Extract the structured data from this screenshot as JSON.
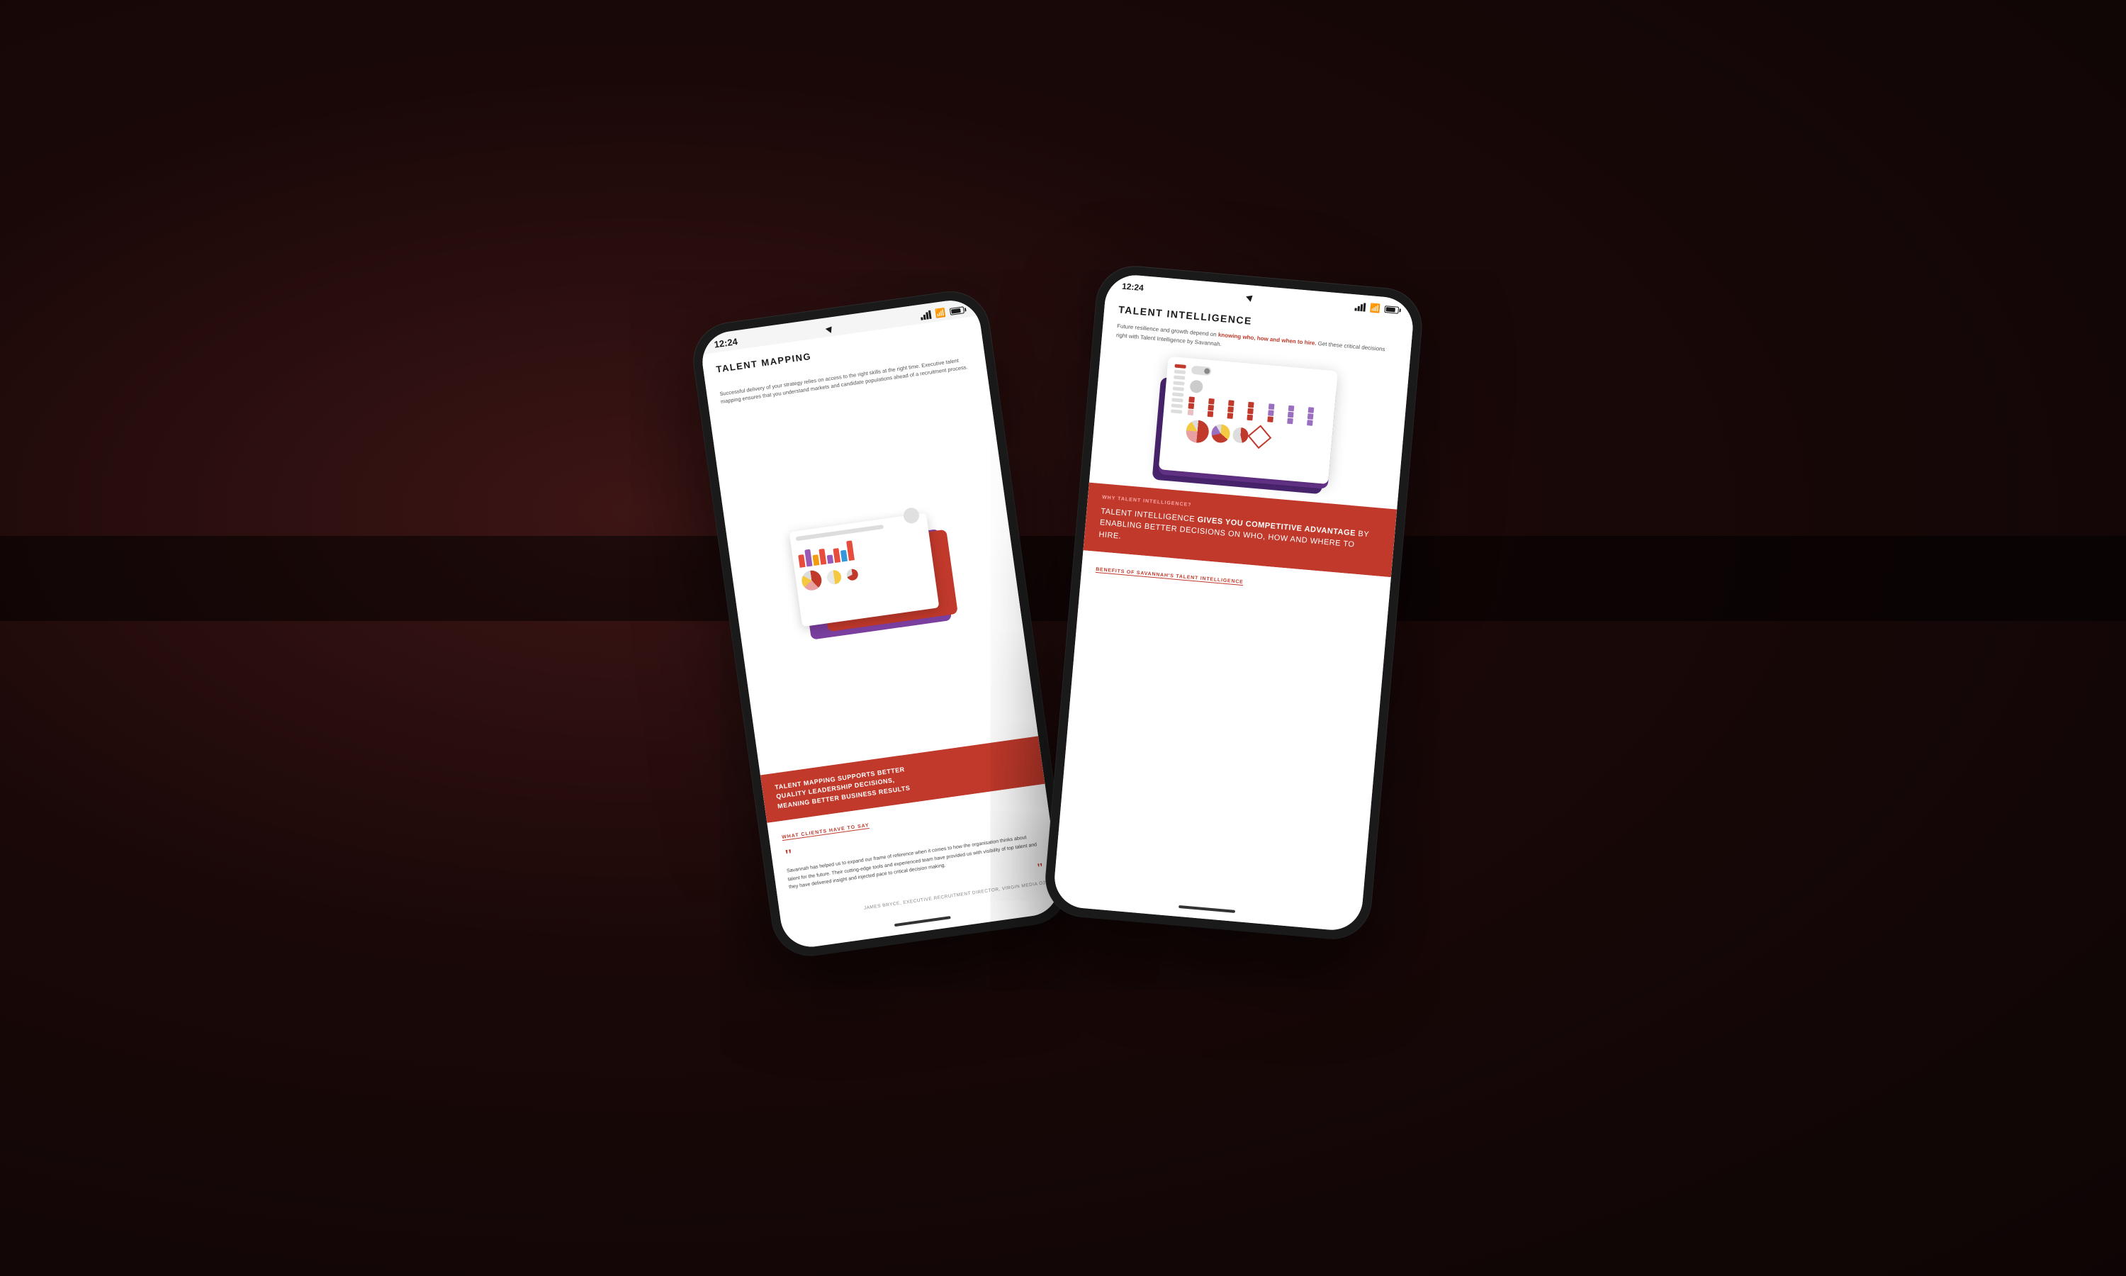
{
  "background": {
    "color": "#1a0808"
  },
  "phone1": {
    "status_bar": {
      "time": "12:24",
      "has_location": true
    },
    "title": "TALENT MAPPING",
    "body_text": "Successful delivery of your strategy relies on access to the right skills at the right time. Executive talent mapping ensures that you understand markets and candidate populations ahead of a recruitment process.",
    "red_banner": {
      "line1": "TALENT MAPPING SUPPORTS BETTER",
      "line2": "QUALITY LEADERSHIP DECISIONS,",
      "line3_prefix": "MEANING ",
      "line3_bold": "BETTER BUSINESS RESULTS"
    },
    "testimonial_link": "WHAT CLIENTS HAVE TO SAY",
    "quote_open": "““",
    "testimonial_text": "Savannah has helped us to expand our frame of reference when it comes to how the organisation thinks about talent for the future. Their cutting-edge tools and experienced team have provided us with visibility of top talent and they have delivered insight and injected pace to critical decision making.",
    "quote_close": "””",
    "author": "JAMES BRYCE, EXECUTIVE RECRUITMENT DIRECTOR, VIRGIN MEDIA O2"
  },
  "phone2": {
    "status_bar": {
      "time": "12:24",
      "has_location": true
    },
    "title": "TALENT INTELLIGENCE",
    "hero_text_prefix": "Future resilience and growth depend on ",
    "hero_text_bold": "knowing who, how and when to hire.",
    "hero_text_suffix": " Get these critical decisions right with Talent Intelligence by Savannah.",
    "why_label": "WHY TALENT INTELLIGENCE?",
    "red_main_text_prefix": "TALENT INTELLIGENCE ",
    "red_bold_1": "GIVES YOU COMPETITIVE ADVANTAGE",
    "red_main_text_mid": " BY ENABLING BETTER DECISIONS ON WHO, HOW AND WHERE TO HIRE.",
    "benefits_link": "BENEFITS OF SAVANNAH'S TALENT INTELLIGENCE"
  }
}
